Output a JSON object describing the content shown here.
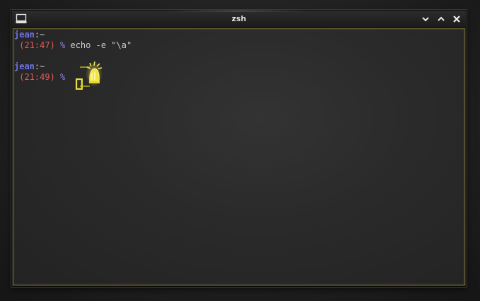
{
  "window": {
    "title": "zsh",
    "accent_color": "#d8d020"
  },
  "icons": {
    "app": "terminal-icon",
    "minimize": "chevron-down-icon",
    "maximize": "chevron-up-icon",
    "close": "close-icon",
    "bell": "bell-icon"
  },
  "terminal": {
    "lines": [
      {
        "user": "jean",
        "sep": ":",
        "dir": "~"
      },
      {
        "time": " (21:47)",
        "prompt": " %",
        "command": " echo -e \"\\a\""
      },
      {
        "blank": true
      },
      {
        "user": "jean",
        "sep": ":",
        "dir": "~"
      },
      {
        "time": " (21:49)",
        "prompt": " %",
        "command": " "
      }
    ]
  }
}
